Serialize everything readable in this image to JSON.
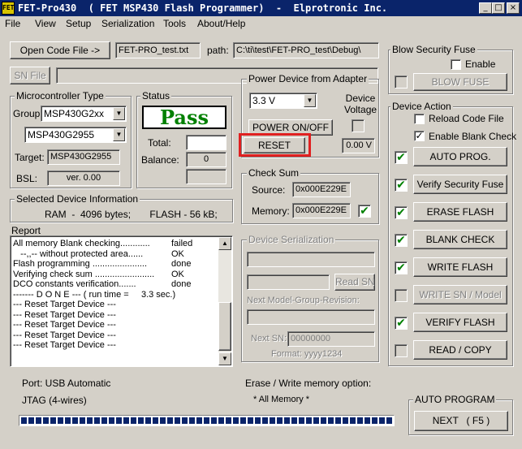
{
  "window": {
    "title": "FET-Pro430  ( FET MSP430 Flash Programmer)  -  Elprotronic Inc.",
    "app_icon_text": "FET",
    "min_glyph": "_",
    "max_glyph": "□",
    "close_glyph": "×"
  },
  "menu": [
    "File",
    "View",
    "Setup",
    "Serialization",
    "Tools",
    "About/Help"
  ],
  "top": {
    "open_code_file": "Open Code File       ->",
    "code_file_name": "FET-PRO_test.txt",
    "path_label": "path:",
    "path_value": "C:\\ti\\test\\FET-PRO_test\\Debug\\",
    "sn_file": "SN File"
  },
  "microcontroller": {
    "title": "Microcontroller Type",
    "group_label": "Group:",
    "group_value": "MSP430G2xx",
    "device_value": "MSP430G2955",
    "target_label": "Target:",
    "target_value": "MSP430G2955",
    "bsl_label": "BSL:",
    "bsl_value": "ver.  0.00"
  },
  "status": {
    "title": "Status",
    "result": "Pass",
    "total_label": "Total:",
    "total_value": "",
    "balance_label": "Balance:",
    "balance_value": "0",
    "extra_value": ""
  },
  "power": {
    "title": "Power Device from Adapter",
    "voltage_value": "3.3 V",
    "device_voltage_label": "Device\nVoltage",
    "power_button": "POWER ON/OFF",
    "reset_button": "RESET",
    "device_voltage_value": "0.00 V"
  },
  "checksum": {
    "title": "Check Sum",
    "source_label": "Source:",
    "source_value": "0x000E229E",
    "memory_label": "Memory:",
    "memory_value": "0x000E229E"
  },
  "selected_device": {
    "title": "Selected Device Information",
    "info": "RAM  -  4096 bytes;       FLASH - 56 kB;"
  },
  "report": {
    "title": "Report",
    "lines": [
      [
        "All memory Blank checking............",
        "failed"
      ],
      [
        "   --,,-- without protected area......",
        "OK"
      ],
      [
        "Flash programming ......................",
        "done"
      ],
      [
        "Verifying check sum ........................",
        "OK"
      ],
      [
        "DCO constants verification.......",
        "done"
      ],
      [
        "------- D O N E --- ( run time =     3.3 sec.)",
        ""
      ],
      [
        "--- Reset Target Device ---",
        ""
      ],
      [
        "--- Reset Target Device ---",
        ""
      ],
      [
        "--- Reset Target Device ---",
        ""
      ],
      [
        "--- Reset Target Device ---",
        ""
      ],
      [
        "--- Reset Target Device ---",
        ""
      ]
    ]
  },
  "serialization": {
    "title": "Device Serialization",
    "read_sn": "Read SN",
    "next_model_label": "Next Model-Group-Revision:",
    "next_sn_label": "Next SN:",
    "next_sn_value": "00000000",
    "format_label": "Format: yyyy1234"
  },
  "blow_fuse": {
    "title": "Blow Security Fuse",
    "enable_label": "Enable",
    "button": "BLOW FUSE"
  },
  "device_action": {
    "title": "Device Action",
    "reload_label": "Reload Code File",
    "enable_blank_label": "Enable Blank Check",
    "buttons": [
      "AUTO PROG.",
      "Verify Security Fuse",
      "ERASE FLASH",
      "BLANK CHECK",
      "WRITE FLASH",
      "WRITE SN / Model",
      "VERIFY FLASH",
      "READ / COPY"
    ]
  },
  "bottom": {
    "port": "Port: USB Automatic",
    "jtag": "JTAG (4-wires)",
    "erase_write_label": "Erase / Write memory option:",
    "erase_write_value": "* All Memory *",
    "auto_program_title": "AUTO PROGRAM",
    "next_button": "NEXT   ( F5 )",
    "progress": 1.0
  },
  "colors": {
    "titlebar": "#0a246a",
    "pass": "#008000",
    "highlight": "#e02020",
    "check": "#008000"
  }
}
